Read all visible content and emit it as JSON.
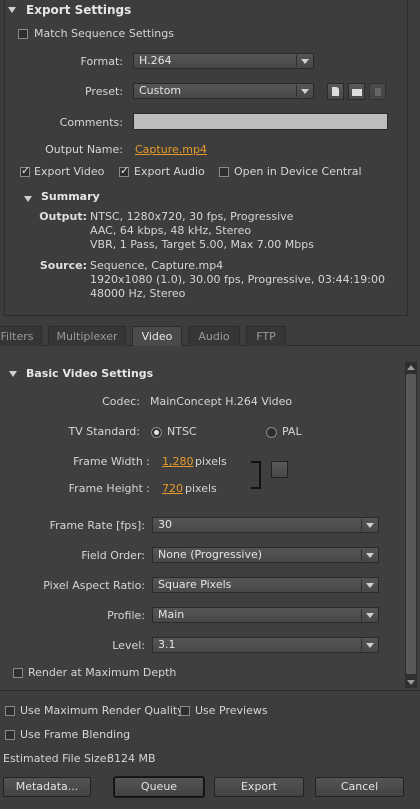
{
  "export": {
    "title": "Export Settings",
    "match_sequence": "Match Sequence Settings",
    "format_label": "Format:",
    "format_value": "H.264",
    "preset_label": "Preset:",
    "preset_value": "Custom",
    "comments_label": "Comments:",
    "comments_value": "",
    "output_name_label": "Output Name:",
    "output_name_value": "Capture.mp4",
    "export_video": "Export Video",
    "export_audio": "Export Audio",
    "open_device_central": "Open in Device Central"
  },
  "summary": {
    "title": "Summary",
    "output_label": "Output:",
    "output_lines": [
      "NTSC, 1280x720, 30 fps, Progressive",
      "AAC, 64 kbps, 48 kHz, Stereo",
      "VBR, 1 Pass, Target 5.00, Max 7.00 Mbps"
    ],
    "source_label": "Source:",
    "source_lines": [
      "Sequence, Capture.mp4",
      "1920x1080 (1.0), 30.00 fps, Progressive, 03:44:19:00",
      "48000 Hz, Stereo"
    ]
  },
  "tabs": [
    "Filters",
    "Multiplexer",
    "Video",
    "Audio",
    "FTP"
  ],
  "video": {
    "title": "Basic Video Settings",
    "codec_label": "Codec:",
    "codec_value": "MainConcept H.264 Video",
    "tv_label": "TV Standard:",
    "tv_ntsc": "NTSC",
    "tv_pal": "PAL",
    "frame_width_label": "Frame Width :",
    "frame_width_value": "1,280",
    "frame_height_label": "Frame Height :",
    "frame_height_value": "720",
    "pixels_unit": "pixels",
    "frame_rate_label": "Frame Rate [fps]:",
    "frame_rate_value": "30",
    "field_order_label": "Field Order:",
    "field_order_value": "None (Progressive)",
    "par_label": "Pixel Aspect Ratio:",
    "par_value": "Square Pixels",
    "profile_label": "Profile:",
    "profile_value": "Main",
    "level_label": "Level:",
    "level_value": "3.1",
    "render_max_depth": "Render at Maximum Depth"
  },
  "footer": {
    "max_render_quality": "Use Maximum Render Quality",
    "use_previews": "Use Previews",
    "frame_blending": "Use Frame Blending",
    "file_size_label": "Estimated File Size:",
    "file_size_value": "8124 MB",
    "metadata_btn": "Metadata...",
    "queue_btn": "Queue",
    "export_btn": "Export",
    "cancel_btn": "Cancel"
  },
  "colors": {
    "accent_link": "#e59a2a",
    "panel_bg": "#3d3d3d"
  }
}
